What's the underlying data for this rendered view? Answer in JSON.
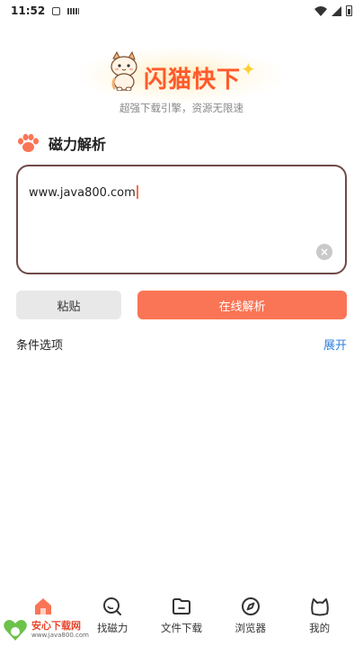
{
  "status_bar": {
    "time": "11:52"
  },
  "logo": {
    "title": "闪猫快下",
    "slogan": "超强下载引擎，资源无限速"
  },
  "section": {
    "title": "磁力解析"
  },
  "input": {
    "value": "www.java800.com"
  },
  "buttons": {
    "paste": "粘贴",
    "parse": "在线解析"
  },
  "options": {
    "label": "条件选项",
    "expand": "展开"
  },
  "nav": {
    "items": [
      {
        "label": "",
        "icon": "home-icon",
        "active": true
      },
      {
        "label": "找磁力",
        "icon": "search-icon"
      },
      {
        "label": "文件下载",
        "icon": "folder-icon"
      },
      {
        "label": "浏览器",
        "icon": "compass-icon"
      },
      {
        "label": "我的",
        "icon": "cat-profile-icon"
      }
    ]
  },
  "watermark": {
    "title": "安心下载网",
    "url": "www.java800.com"
  },
  "colors": {
    "accent": "#fa7555",
    "logo_text": "#ff5a2a",
    "input_border": "#6e4a48",
    "link": "#2f7fe0",
    "home_active": "#fa7555"
  }
}
